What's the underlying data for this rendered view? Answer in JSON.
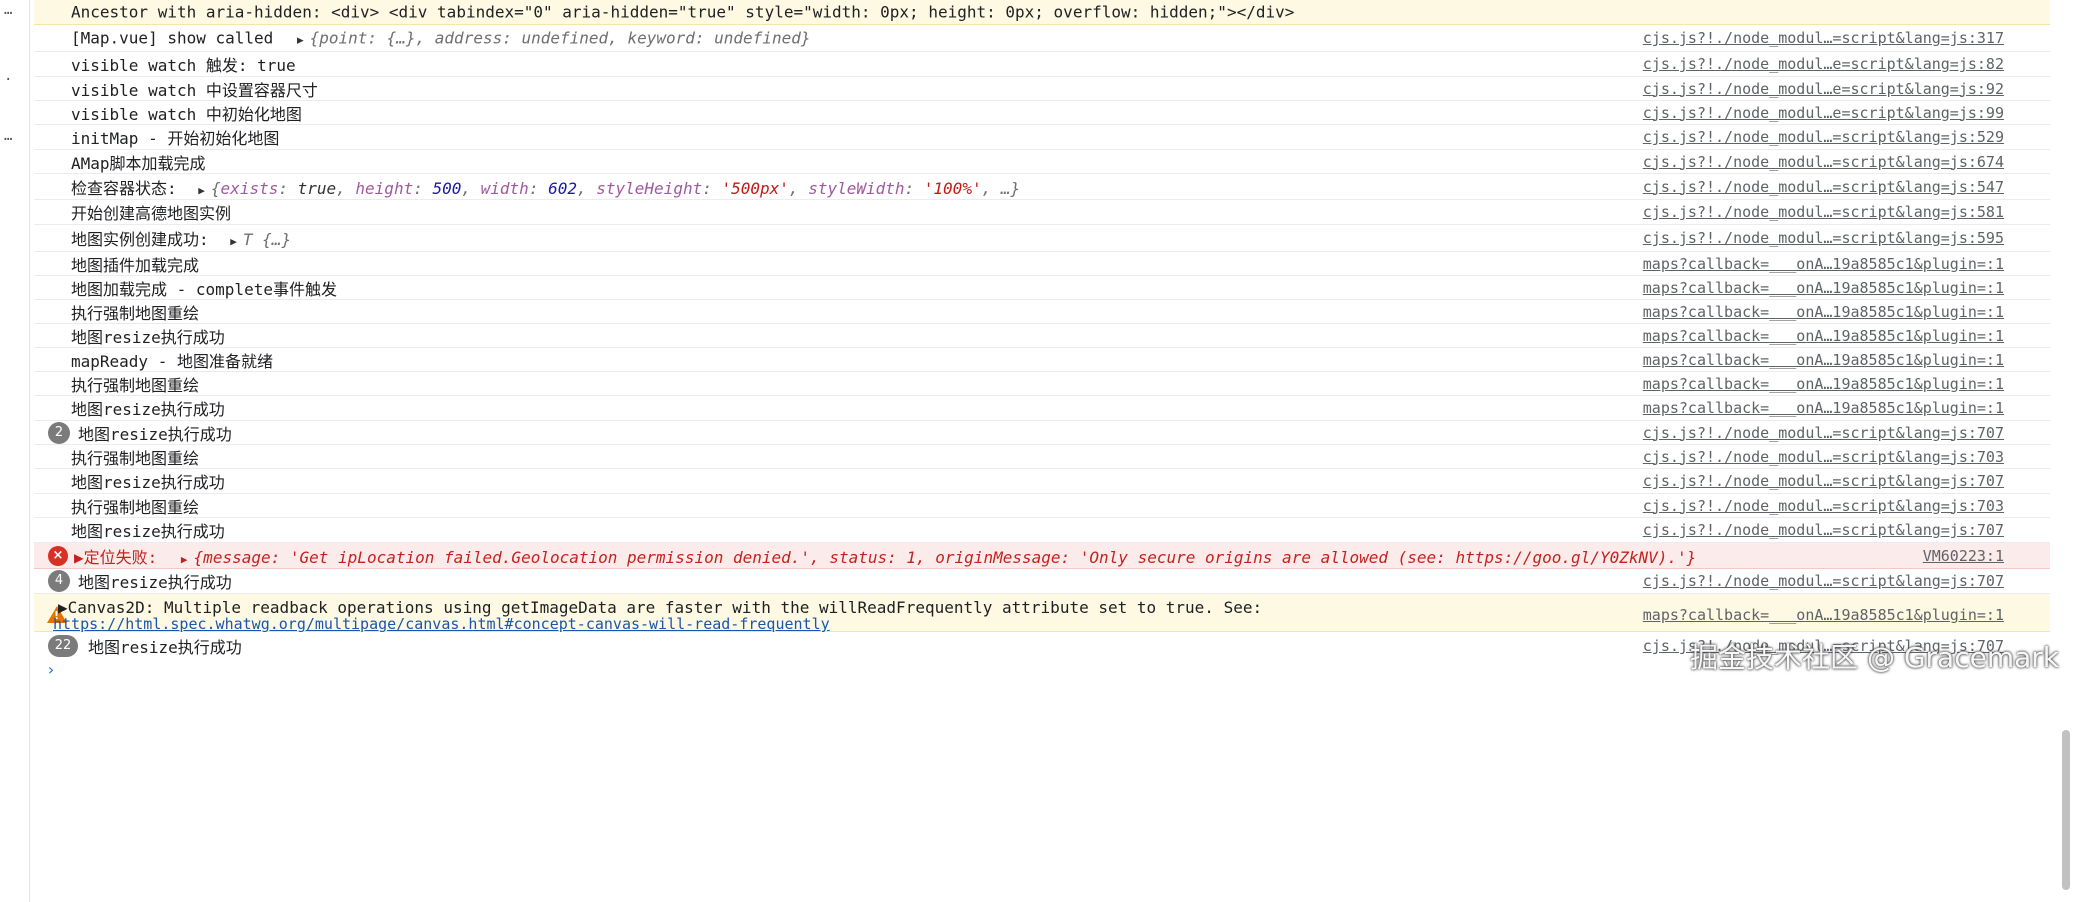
{
  "left_strip": {
    "marks": [
      "…",
      "·",
      "…"
    ]
  },
  "rows": {
    "r0": {
      "msg": "Ancestor with aria-hidden: <div>    <div tabindex=\"0\" aria-hidden=\"true\" style=\"width: 0px; height: 0px; overflow: hidden;\"></div>"
    },
    "r1": {
      "msg_prefix": "[Map.vue] show called",
      "obj": "{point: {…}, address: undefined, keyword: undefined}",
      "src": "cjs.js?!./node_modul…=script&lang=js:317"
    },
    "r2": {
      "msg": "visible watch 触发: true",
      "src": "cjs.js?!./node_modul…e=script&lang=js:82"
    },
    "r3": {
      "msg": "visible watch 中设置容器尺寸",
      "src": "cjs.js?!./node_modul…e=script&lang=js:92"
    },
    "r4": {
      "msg": "visible watch 中初始化地图",
      "src": "cjs.js?!./node_modul…e=script&lang=js:99"
    },
    "r5": {
      "msg": "initMap - 开始初始化地图",
      "src": "cjs.js?!./node_modul…=script&lang=js:529"
    },
    "r6": {
      "msg": "AMap脚本加载完成",
      "src": "cjs.js?!./node_modul…=script&lang=js:674"
    },
    "r7": {
      "msg_prefix": "检查容器状态:",
      "obj_open": "{",
      "k1": "exists",
      "v1": "true",
      "k2": "height",
      "v2": "500",
      "k3": "width",
      "v3": "602",
      "k4": "styleHeight",
      "v4": "'500px'",
      "k5": "styleWidth",
      "v5": "'100%'",
      "obj_close": "…}",
      "src": "cjs.js?!./node_modul…=script&lang=js:547"
    },
    "r8": {
      "msg": "开始创建高德地图实例",
      "src": "cjs.js?!./node_modul…=script&lang=js:581"
    },
    "r9": {
      "msg_prefix": "地图实例创建成功:",
      "obj": "T  {…}",
      "src": "cjs.js?!./node_modul…=script&lang=js:595"
    },
    "r10": {
      "msg": "地图插件加载完成",
      "src": "maps?callback=___onA…19a8585c1&plugin=:1"
    },
    "r11": {
      "msg": "地图加载完成 - complete事件触发",
      "src": "maps?callback=___onA…19a8585c1&plugin=:1"
    },
    "r12": {
      "msg": "执行强制地图重绘",
      "src": "maps?callback=___onA…19a8585c1&plugin=:1"
    },
    "r13": {
      "msg": "地图resize执行成功",
      "src": "maps?callback=___onA…19a8585c1&plugin=:1"
    },
    "r14": {
      "msg": "mapReady - 地图准备就绪",
      "src": "maps?callback=___onA…19a8585c1&plugin=:1"
    },
    "r15": {
      "msg": "执行强制地图重绘",
      "src": "maps?callback=___onA…19a8585c1&plugin=:1"
    },
    "r16": {
      "msg": "地图resize执行成功",
      "src": "maps?callback=___onA…19a8585c1&plugin=:1"
    },
    "r17": {
      "badge": "2",
      "msg": "地图resize执行成功",
      "src": "cjs.js?!./node_modul…=script&lang=js:707"
    },
    "r18": {
      "msg": "执行强制地图重绘",
      "src": "cjs.js?!./node_modul…=script&lang=js:703"
    },
    "r19": {
      "msg": "地图resize执行成功",
      "src": "cjs.js?!./node_modul…=script&lang=js:707"
    },
    "r20": {
      "msg": "执行强制地图重绘",
      "src": "cjs.js?!./node_modul…=script&lang=js:703"
    },
    "r21": {
      "msg": "地图resize执行成功",
      "src": "cjs.js?!./node_modul…=script&lang=js:707"
    },
    "r22": {
      "msg_prefix": "▶定位失败:",
      "obj": "{message: 'Get ipLocation failed.Geolocation permission denied.', status: 1, originMessage: 'Only secure origins are allowed (see: https://goo.gl/Y0ZkNV).'}",
      "src": "VM60223:1"
    },
    "r23": {
      "badge": "4",
      "msg": "地图resize执行成功",
      "src": "cjs.js?!./node_modul…=script&lang=js:707"
    },
    "r24": {
      "msg": "▶Canvas2D: Multiple readback operations using getImageData are faster with the willReadFrequently attribute set to true. See:",
      "link": "https://html.spec.whatwg.org/multipage/canvas.html#concept-canvas-will-read-frequently",
      "src": "maps?callback=___onA…19a8585c1&plugin=:1"
    },
    "r25": {
      "badge": "22",
      "msg": "地图resize执行成功",
      "src": "cjs.js?!./node_modul…=script&lang=js:707"
    }
  },
  "prompt": "›",
  "watermark": "掘金技术社区 @ Gracemark",
  "colors": {
    "error": "#d93025",
    "warning": "#e37400",
    "link": "#1a55b0",
    "badge": "#7b7b7b"
  }
}
